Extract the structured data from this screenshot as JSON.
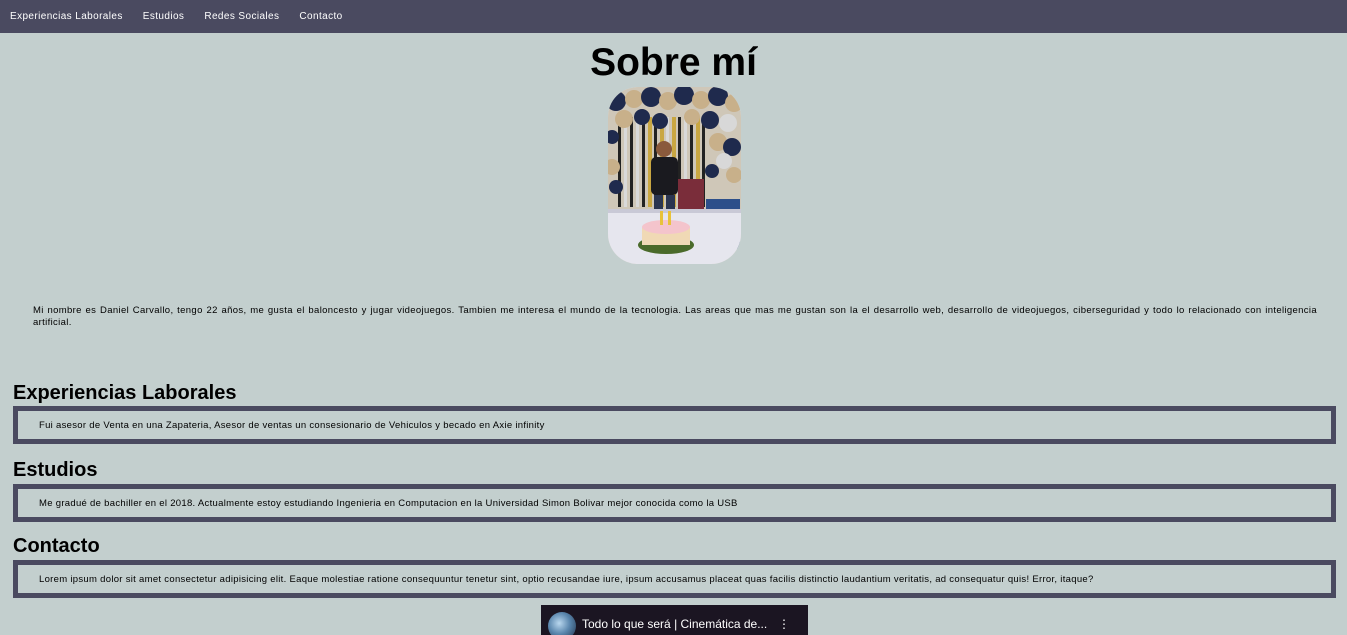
{
  "nav": {
    "items": [
      {
        "label": "Experiencias Laborales"
      },
      {
        "label": "Estudios"
      },
      {
        "label": "Redes Sociales"
      },
      {
        "label": "Contacto"
      }
    ]
  },
  "about": {
    "title": "Sobre mí",
    "text": "Mi nombre es Daniel Carvallo, tengo 22 años, me gusta el baloncesto y jugar videojuegos. Tambien me interesa el mundo de la tecnologia. Las areas que mas me gustan son la el desarrollo web, desarrollo de videojuegos, ciberseguridad y todo lo relacionado con inteligencia artificial."
  },
  "sections": {
    "experience": {
      "heading": "Experiencias Laborales",
      "text": "Fui asesor de Venta en una Zapateria, Asesor de ventas un consesionario de Vehiculos y becado en Axie infinity"
    },
    "studies": {
      "heading": "Estudios",
      "text": "Me gradué de bachiller en el 2018. Actualmente estoy estudiando Ingenieria en Computacion en la Universidad Simon Bolivar mejor conocida como la USB"
    },
    "contact": {
      "heading": "Contacto",
      "text": "Lorem ipsum dolor sit amet consectetur adipisicing elit. Eaque molestiae ratione consequuntur tenetur sint, optio recusandae iure, ipsum accusamus placeat quas facilis distinctio laudantium veritatis, ad consequatur quis! Error, itaque?"
    }
  },
  "video": {
    "title": "Todo lo que será | Cinemática de...",
    "more_icon": "more-vert-icon"
  },
  "colors": {
    "background": "#c3cfce",
    "navbar": "#4a4a60",
    "box_border": "#4a4a60"
  }
}
